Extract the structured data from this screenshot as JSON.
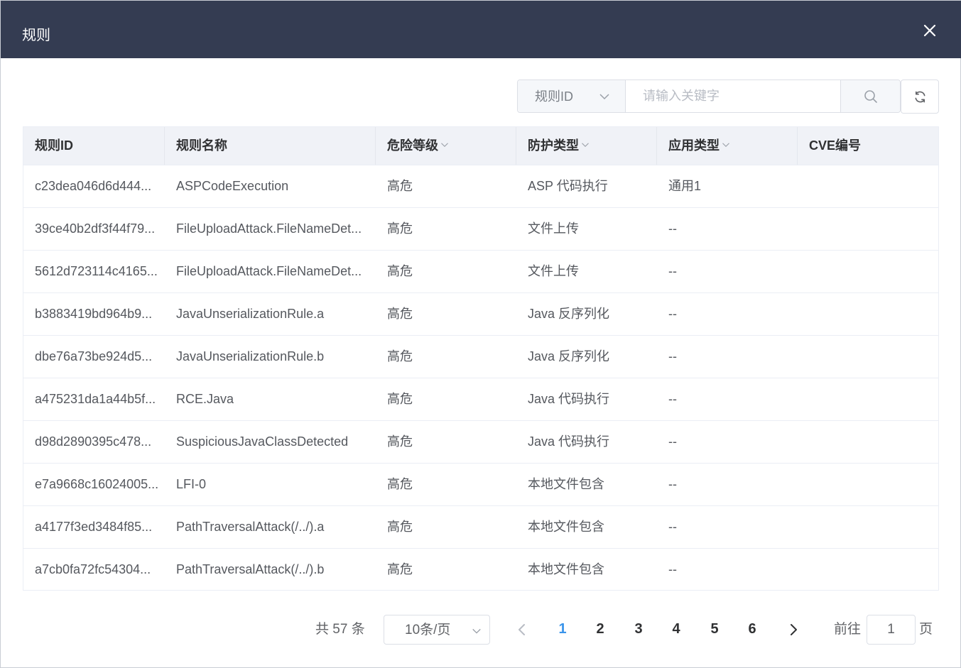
{
  "dialog": {
    "title": "规则"
  },
  "search": {
    "field_select": "规则ID",
    "placeholder": "请输入关键字"
  },
  "table": {
    "headers": [
      {
        "label": "规则ID",
        "filter": false
      },
      {
        "label": "规则名称",
        "filter": false
      },
      {
        "label": "危险等级",
        "filter": true
      },
      {
        "label": "防护类型",
        "filter": true
      },
      {
        "label": "应用类型",
        "filter": true
      },
      {
        "label": "CVE编号",
        "filter": false
      }
    ],
    "rows": [
      [
        "c23dea046d6d444...",
        "ASPCodeExecution",
        "高危",
        "ASP 代码执行",
        "通用1",
        ""
      ],
      [
        "39ce40b2df3f44f79...",
        "FileUploadAttack.FileNameDet...",
        "高危",
        "文件上传",
        "--",
        ""
      ],
      [
        "5612d723114c4165...",
        "FileUploadAttack.FileNameDet...",
        "高危",
        "文件上传",
        "--",
        ""
      ],
      [
        "b3883419bd964b9...",
        "JavaUnserializationRule.a",
        "高危",
        "Java 反序列化",
        "--",
        ""
      ],
      [
        "dbe76a73be924d5...",
        "JavaUnserializationRule.b",
        "高危",
        "Java 反序列化",
        "--",
        ""
      ],
      [
        "a475231da1a44b5f...",
        "RCE.Java",
        "高危",
        "Java 代码执行",
        "--",
        ""
      ],
      [
        "d98d2890395c478...",
        "SuspiciousJavaClassDetected",
        "高危",
        "Java 代码执行",
        "--",
        ""
      ],
      [
        "e7a9668c16024005...",
        "LFI-0",
        "高危",
        "本地文件包含",
        "--",
        ""
      ],
      [
        "a4177f3ed3484f85...",
        "PathTraversalAttack(/../).a",
        "高危",
        "本地文件包含",
        "--",
        ""
      ],
      [
        "a7cb0fa72fc54304...",
        "PathTraversalAttack(/../).b",
        "高危",
        "本地文件包含",
        "--",
        ""
      ]
    ]
  },
  "pagination": {
    "total": "共 57 条",
    "page_size": "10条/页",
    "pages": [
      "1",
      "2",
      "3",
      "4",
      "5",
      "6"
    ],
    "current": "1",
    "goto_label": "前往",
    "goto_value": "1",
    "page_suffix": "页"
  },
  "colors": {
    "header_bg": "#343c52",
    "active_page": "#3a94ea",
    "table_header_bg": "#f0f2f7"
  },
  "icons": [
    "close-icon",
    "chevron-down-icon",
    "search-icon",
    "refresh-icon",
    "chevron-left-icon",
    "chevron-right-icon"
  ]
}
